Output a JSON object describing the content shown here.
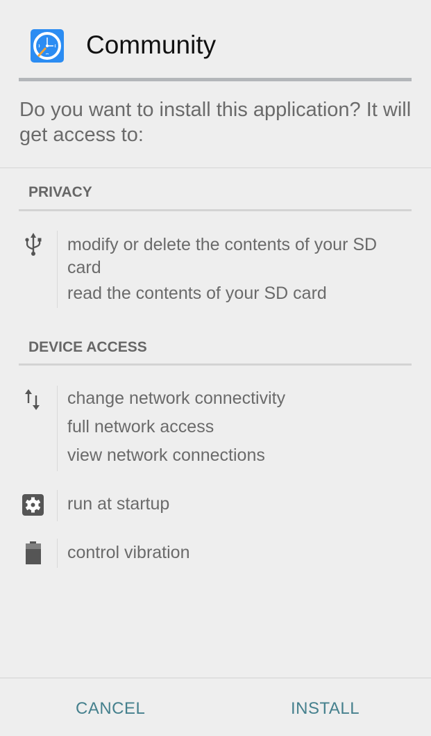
{
  "header": {
    "app_name": "Community",
    "app_icon": "clock-compass-icon",
    "app_icon_color": "#2b8cf2"
  },
  "prompt": "Do you want to install this application? It will get access to:",
  "sections": [
    {
      "label": "PRIVACY",
      "groups": [
        {
          "icon": "usb-icon",
          "permissions": [
            "modify or delete the contents of your SD card",
            "read the contents of your SD card"
          ]
        }
      ]
    },
    {
      "label": "DEVICE ACCESS",
      "groups": [
        {
          "icon": "network-arrows-icon",
          "permissions": [
            "change network connectivity",
            "full network access",
            "view network connections"
          ]
        },
        {
          "icon": "settings-gear-icon",
          "permissions": [
            "run at startup"
          ]
        },
        {
          "icon": "battery-icon",
          "permissions": [
            "control vibration"
          ]
        }
      ]
    }
  ],
  "buttons": {
    "cancel": "CANCEL",
    "install": "INSTALL",
    "accent_color": "#45808d"
  }
}
